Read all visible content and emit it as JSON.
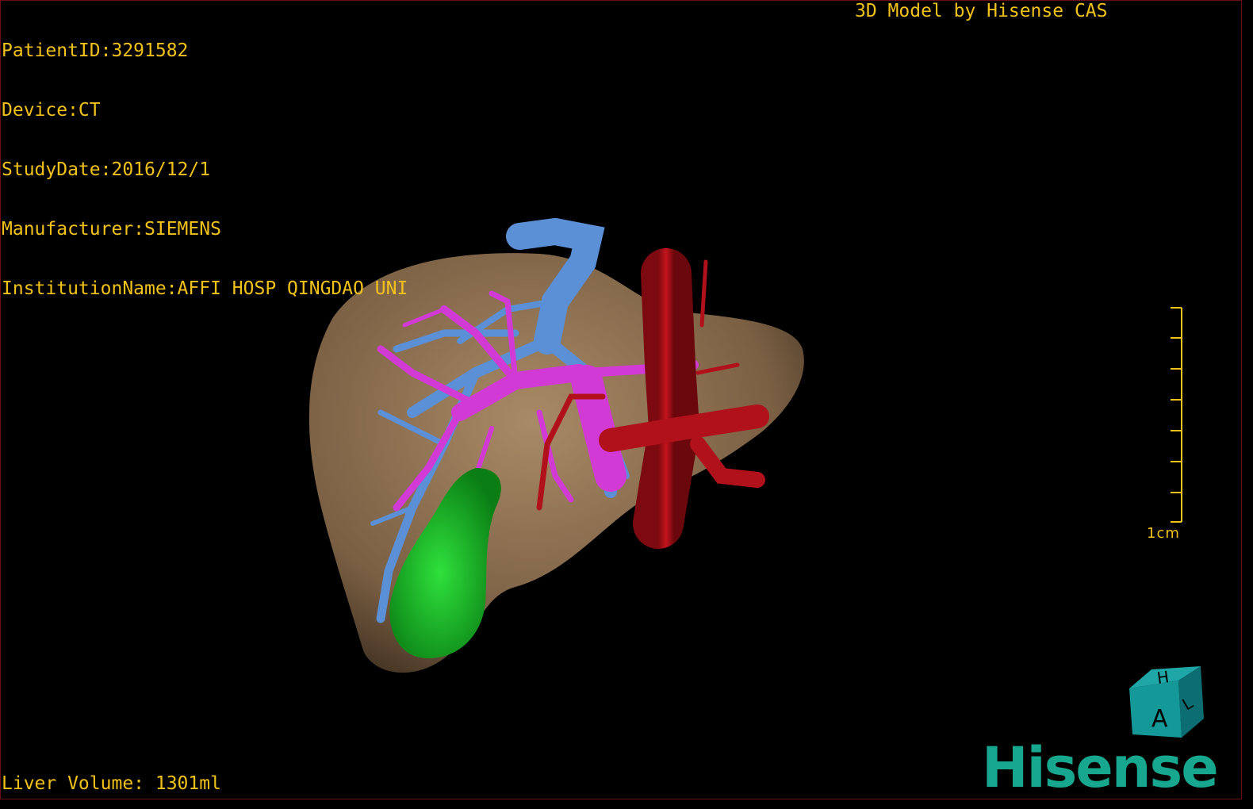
{
  "header": {
    "patient_id": "PatientID:3291582",
    "device": "Device:CT",
    "study_date": "StudyDate:2016/12/1",
    "manufacturer": "Manufacturer:SIEMENS",
    "institution": "InstitutionName:AFFI HOSP QINGDAO UNI"
  },
  "credit": "3D Model by Hisense CAS",
  "footer": {
    "liver_volume": "Liver Volume: 1301ml"
  },
  "scale": {
    "label": "1cm"
  },
  "orientation_cube": {
    "face_front": "A",
    "face_top": "H",
    "face_side": "L",
    "icon": "orientation-cube-icon"
  },
  "logo": {
    "text": "Hisense"
  },
  "colors": {
    "overlay_text": "#f2c21b",
    "liver": "#8a6d4e",
    "hepatic_vein": "#5b8fd6",
    "portal_vein": "#d23ad6",
    "artery": "#b0111a",
    "gallbladder": "#11b520",
    "brand": "#17a78f"
  }
}
